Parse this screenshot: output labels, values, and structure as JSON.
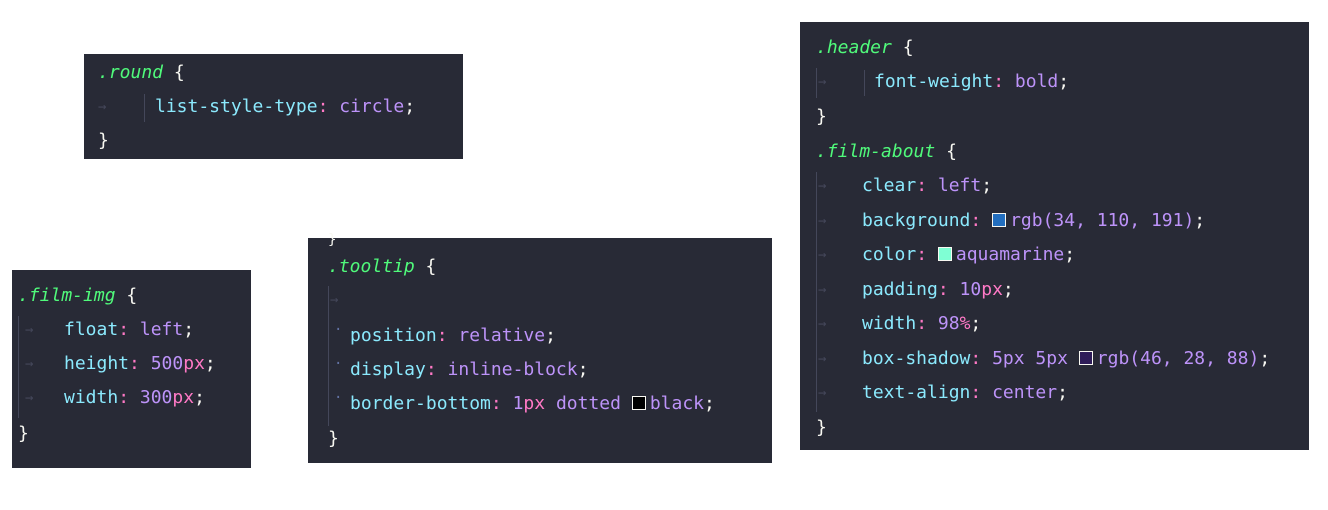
{
  "round": {
    "selector": ".round",
    "prop1": "list-style-type",
    "val1": "circle"
  },
  "film_img": {
    "selector": ".film-img",
    "prop1": "float",
    "val1": "left",
    "prop2": "height",
    "num2": "500",
    "unit2": "px",
    "prop3": "width",
    "num3": "300",
    "unit3": "px"
  },
  "tooltip": {
    "selector": ".tooltip",
    "prop1": "position",
    "val1": "relative",
    "prop2": "display",
    "val2": "inline-block",
    "prop3": "border-bottom",
    "num3": "1",
    "unit3": "px",
    "val3b": "dotted",
    "val3c": "black"
  },
  "header": {
    "selector": ".header",
    "prop1": "font-weight",
    "val1": "bold"
  },
  "film_about": {
    "selector": ".film-about",
    "prop1": "clear",
    "val1": "left",
    "prop2": "background",
    "val2": "rgb(34, 110, 191)",
    "prop3": "color",
    "val3": "aquamarine",
    "prop4": "padding",
    "num4": "10",
    "unit4": "px",
    "prop5": "width",
    "num5": "98",
    "unit5": "%",
    "prop6": "box-shadow",
    "val6a": "5px 5px",
    "val6b": "rgb(46, 28, 88)",
    "prop7": "text-align",
    "val7": "center"
  },
  "colors": {
    "background_swatch": "#226ebf",
    "aquamarine_swatch": "#7fffd4",
    "shadow_swatch": "#2e1c58",
    "black_swatch": "#000000"
  },
  "punctuation": {
    "open": "{",
    "close": "}",
    "colon": ":",
    "semicolon": ";"
  }
}
